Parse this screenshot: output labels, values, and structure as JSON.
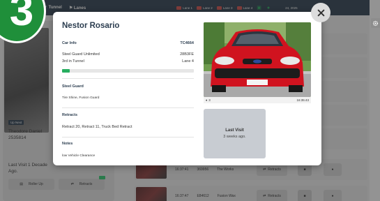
{
  "step_badge": "3",
  "topbar": {
    "filter_1": "Tunnel",
    "filter_2": "Lanes",
    "lanes": [
      "Lane 1",
      "Lane 2",
      "Lane 3",
      "Lane 4"
    ],
    "date": "24, 2025"
  },
  "background": {
    "up_next_badge": "Up Next",
    "customer_name": "Theodore Daniel",
    "customer_id": "2535814",
    "last_visit_line1": "Last Visit 1 Decade",
    "last_visit_line2": "Ago.",
    "button_1": "Roller Up",
    "button_2": "Retracts",
    "queue_rows": [
      {
        "time": "16:37:41",
        "code": "369956",
        "service": "The Works",
        "action": "Retracts"
      },
      {
        "time": "16:37:47",
        "code": "E84612",
        "service": "Fusion Wax",
        "action": "Retracts"
      }
    ]
  },
  "modal": {
    "customer_name": "Nestor Rosario",
    "car_info": {
      "label": "Car Info",
      "plate": "TC4664",
      "plan": "Steel Guard Unlimited",
      "code": "28B3FE",
      "position": "3rd in Tunnel",
      "lane": "Lane 4",
      "progress": 0.06
    },
    "package": {
      "label": "Steel Guard",
      "items": "Tire Shine, Fusion Guard"
    },
    "retracts": {
      "label": "Retracts",
      "items": "Retract 20, Retract 11, Truck Bed Retract"
    },
    "notes": {
      "label": "Notes",
      "text": "low Vehicle Clearance"
    },
    "photo": {
      "count": "3",
      "timestamp": "16:35:43"
    },
    "last_visit": {
      "title": "Last Visit",
      "value": "3 weeks ago."
    }
  },
  "colors": {
    "accent_green": "#27ae60",
    "badge_green": "#1f8f3a",
    "title_navy": "#2c3e50",
    "lane_red": "#d9534f"
  },
  "icons": {
    "close": "close-icon",
    "settings": "gear-icon",
    "photo_count": "car-icon"
  }
}
